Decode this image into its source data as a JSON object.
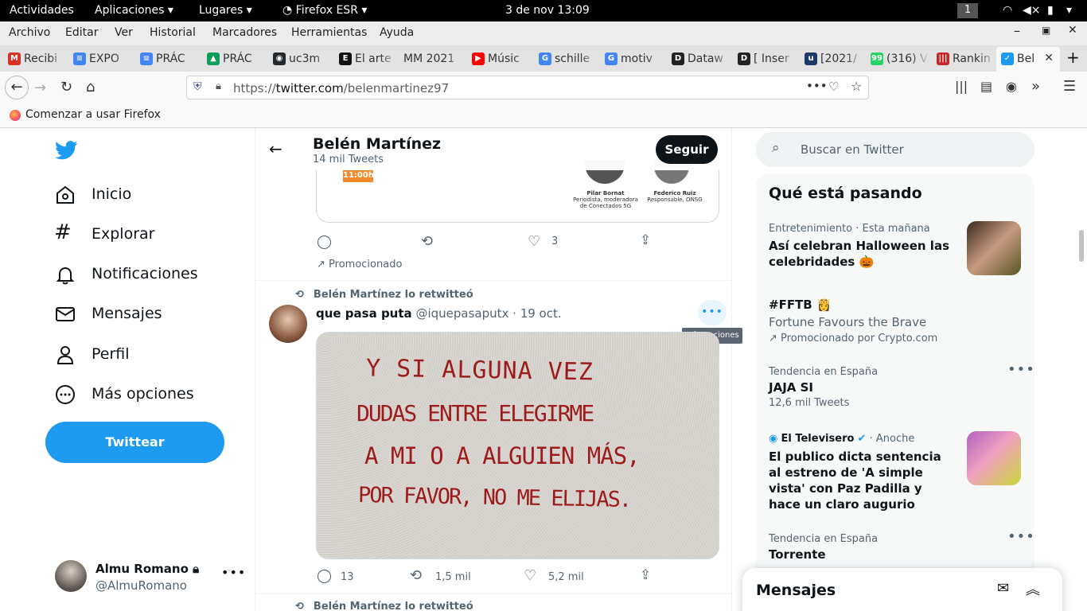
{
  "gnome": {
    "activities": "Actividades",
    "applications": "Aplicaciones",
    "places": "Lugares",
    "app": "Firefox ESR",
    "clock": "3 de nov  13:09",
    "workspace": "1"
  },
  "menu": [
    "Archivo",
    "Editar",
    "Ver",
    "Historial",
    "Marcadores",
    "Herramientas",
    "Ayuda"
  ],
  "tabs": [
    {
      "label": "Recibi",
      "icon": "gmail-icon",
      "color": "#d93025",
      "glyph": "M"
    },
    {
      "label": "EXPO",
      "icon": "google-docs-icon",
      "color": "#4285f4",
      "glyph": "≡"
    },
    {
      "label": "PRÁC",
      "icon": "google-docs-icon",
      "color": "#4285f4",
      "glyph": "≡"
    },
    {
      "label": "PRÁC",
      "icon": "google-drive-icon",
      "color": "#0f9d58",
      "glyph": "▲"
    },
    {
      "label": "uc3m",
      "icon": "github-icon",
      "color": "#24292e",
      "glyph": "◉"
    },
    {
      "label": "El arte",
      "icon": "e-icon",
      "color": "#111",
      "glyph": "E"
    },
    {
      "label": "MM 2021",
      "icon": "",
      "color": "#e3e3e3",
      "glyph": ""
    },
    {
      "label": "Músic",
      "icon": "youtube-icon",
      "color": "#ff0000",
      "glyph": "▶"
    },
    {
      "label": "schille",
      "icon": "google-icon",
      "color": "#4285f4",
      "glyph": "G"
    },
    {
      "label": "motiv",
      "icon": "google-icon",
      "color": "#4285f4",
      "glyph": "G"
    },
    {
      "label": "Dataw",
      "icon": "d-icon",
      "color": "#222",
      "glyph": "D"
    },
    {
      "label": "[ Inser",
      "icon": "d-icon",
      "color": "#222",
      "glyph": "D"
    },
    {
      "label": "[2021/",
      "icon": "uc3m-icon",
      "color": "#1b3a6b",
      "glyph": "u"
    },
    {
      "label": "(316) V",
      "icon": "whatsapp-icon",
      "color": "#25d366",
      "glyph": "99"
    },
    {
      "label": "Rankin",
      "icon": "ranking-icon",
      "color": "#c62828",
      "glyph": "|||"
    },
    {
      "label": "Bel",
      "icon": "twitter-icon",
      "color": "#1d9bf0",
      "glyph": "✓"
    }
  ],
  "url": {
    "prefix": "https://",
    "domain": "twitter.com",
    "path": "/belenmartinez97"
  },
  "bookmark": "Comenzar a usar Firefox",
  "nav": [
    "Inicio",
    "Explorar",
    "Notificaciones",
    "Mensajes",
    "Perfil",
    "Más opciones"
  ],
  "tweet_button": "Twittear",
  "account": {
    "name": "Almu Romano",
    "handle": "@AlmuRomano"
  },
  "profile_header": {
    "name": "Belén Martínez",
    "count": "14 mil Tweets",
    "follow": "Seguir"
  },
  "promo_card": {
    "time": "11:00h",
    "p1_name": "Pilar Bornat",
    "p1_role": "Periodista, moderadora de Conectados 5G",
    "p2_name": "Federico Ruiz",
    "p2_role": "Responsable, ONSG"
  },
  "promo_actions": {
    "likes": "3"
  },
  "promoted": "Promocionado",
  "retweet_label": "Belén Martínez lo retwitteó",
  "tweet": {
    "author": "que pasa puta",
    "handle": "@iquepasaputx",
    "date": "· 19 oct.",
    "tooltip": "Más opciones",
    "handwriting": [
      "Y SI ALGUNA VEZ",
      "DUDAS ENTRE ELEGIRME",
      "A MI O A ALGUIEN MÁS,",
      "POR FAVOR, NO ME ELIJAS."
    ],
    "replies": "13",
    "retweets": "1,5 mil",
    "likes": "5,2 mil"
  },
  "retweet_label2": "Belén Martínez lo retwitteó",
  "search_placeholder": "Buscar en Twitter",
  "trends_title": "Qué está pasando",
  "trends": [
    {
      "meta": "Entretenimiento · Esta mañana",
      "title": "Así celebran Halloween las celebridades 🎃"
    },
    {
      "title": "#FFTB 👸",
      "sub": "Fortune Favours the Brave",
      "promo": "Promocionado por Crypto.com"
    },
    {
      "meta": "Tendencia en España",
      "title": "JAJA SI",
      "sub": "12,6 mil Tweets"
    },
    {
      "source": "El Televisero",
      "meta": "· Anoche",
      "title": "El publico dicta sentencia al estreno de 'A simple vista' con Paz Padilla y hace un claro augurio"
    },
    {
      "meta": "Tendencia en España",
      "title": "Torrente"
    }
  ],
  "messages": "Mensajes",
  "colors": {
    "twitter_blue": "#1d9bf0",
    "handwriting": "#9e1b1b"
  }
}
